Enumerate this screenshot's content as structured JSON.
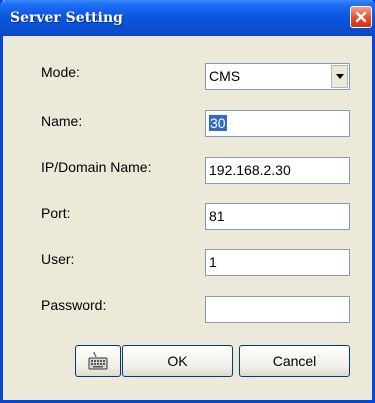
{
  "window": {
    "title": "Server Setting",
    "close_icon": "close-x-icon"
  },
  "form": {
    "mode": {
      "label": "Mode:",
      "value": "CMS",
      "dropdown_icon": "chevron-down-icon"
    },
    "name": {
      "label": "Name:",
      "value": "30"
    },
    "ip": {
      "label": "IP/Domain Name:",
      "value": "192.168.2.30"
    },
    "port": {
      "label": "Port:",
      "value": "81"
    },
    "user": {
      "label": "User:",
      "value": "1"
    },
    "password": {
      "label": "Password:",
      "value": ""
    }
  },
  "buttons": {
    "keyboard_icon": "keyboard-icon",
    "ok": "OK",
    "cancel": "Cancel"
  },
  "colors": {
    "titlebar": "#0a57e0",
    "dialog_background": "#ece9d8",
    "close_button": "#e3502a",
    "selection": "#316ac5"
  }
}
